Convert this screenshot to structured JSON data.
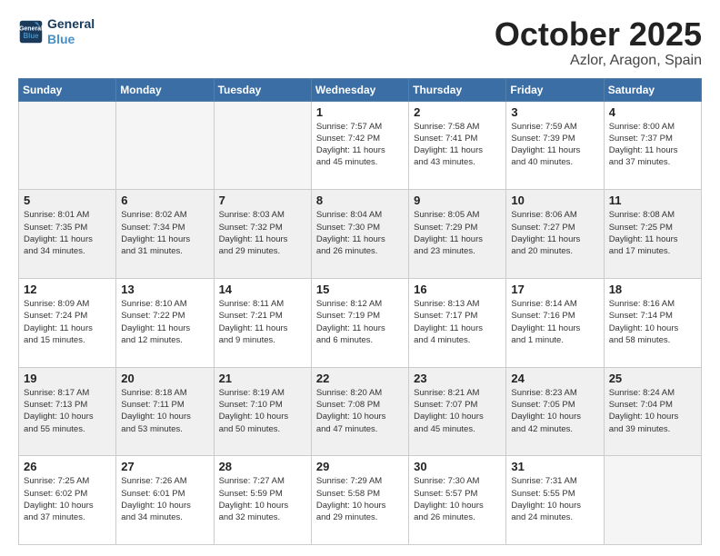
{
  "header": {
    "logo_line1": "General",
    "logo_line2": "Blue",
    "month": "October 2025",
    "location": "Azlor, Aragon, Spain"
  },
  "weekdays": [
    "Sunday",
    "Monday",
    "Tuesday",
    "Wednesday",
    "Thursday",
    "Friday",
    "Saturday"
  ],
  "weeks": [
    [
      {
        "day": "",
        "text": ""
      },
      {
        "day": "",
        "text": ""
      },
      {
        "day": "",
        "text": ""
      },
      {
        "day": "1",
        "text": "Sunrise: 7:57 AM\nSunset: 7:42 PM\nDaylight: 11 hours\nand 45 minutes."
      },
      {
        "day": "2",
        "text": "Sunrise: 7:58 AM\nSunset: 7:41 PM\nDaylight: 11 hours\nand 43 minutes."
      },
      {
        "day": "3",
        "text": "Sunrise: 7:59 AM\nSunset: 7:39 PM\nDaylight: 11 hours\nand 40 minutes."
      },
      {
        "day": "4",
        "text": "Sunrise: 8:00 AM\nSunset: 7:37 PM\nDaylight: 11 hours\nand 37 minutes."
      }
    ],
    [
      {
        "day": "5",
        "text": "Sunrise: 8:01 AM\nSunset: 7:35 PM\nDaylight: 11 hours\nand 34 minutes."
      },
      {
        "day": "6",
        "text": "Sunrise: 8:02 AM\nSunset: 7:34 PM\nDaylight: 11 hours\nand 31 minutes."
      },
      {
        "day": "7",
        "text": "Sunrise: 8:03 AM\nSunset: 7:32 PM\nDaylight: 11 hours\nand 29 minutes."
      },
      {
        "day": "8",
        "text": "Sunrise: 8:04 AM\nSunset: 7:30 PM\nDaylight: 11 hours\nand 26 minutes."
      },
      {
        "day": "9",
        "text": "Sunrise: 8:05 AM\nSunset: 7:29 PM\nDaylight: 11 hours\nand 23 minutes."
      },
      {
        "day": "10",
        "text": "Sunrise: 8:06 AM\nSunset: 7:27 PM\nDaylight: 11 hours\nand 20 minutes."
      },
      {
        "day": "11",
        "text": "Sunrise: 8:08 AM\nSunset: 7:25 PM\nDaylight: 11 hours\nand 17 minutes."
      }
    ],
    [
      {
        "day": "12",
        "text": "Sunrise: 8:09 AM\nSunset: 7:24 PM\nDaylight: 11 hours\nand 15 minutes."
      },
      {
        "day": "13",
        "text": "Sunrise: 8:10 AM\nSunset: 7:22 PM\nDaylight: 11 hours\nand 12 minutes."
      },
      {
        "day": "14",
        "text": "Sunrise: 8:11 AM\nSunset: 7:21 PM\nDaylight: 11 hours\nand 9 minutes."
      },
      {
        "day": "15",
        "text": "Sunrise: 8:12 AM\nSunset: 7:19 PM\nDaylight: 11 hours\nand 6 minutes."
      },
      {
        "day": "16",
        "text": "Sunrise: 8:13 AM\nSunset: 7:17 PM\nDaylight: 11 hours\nand 4 minutes."
      },
      {
        "day": "17",
        "text": "Sunrise: 8:14 AM\nSunset: 7:16 PM\nDaylight: 11 hours\nand 1 minute."
      },
      {
        "day": "18",
        "text": "Sunrise: 8:16 AM\nSunset: 7:14 PM\nDaylight: 10 hours\nand 58 minutes."
      }
    ],
    [
      {
        "day": "19",
        "text": "Sunrise: 8:17 AM\nSunset: 7:13 PM\nDaylight: 10 hours\nand 55 minutes."
      },
      {
        "day": "20",
        "text": "Sunrise: 8:18 AM\nSunset: 7:11 PM\nDaylight: 10 hours\nand 53 minutes."
      },
      {
        "day": "21",
        "text": "Sunrise: 8:19 AM\nSunset: 7:10 PM\nDaylight: 10 hours\nand 50 minutes."
      },
      {
        "day": "22",
        "text": "Sunrise: 8:20 AM\nSunset: 7:08 PM\nDaylight: 10 hours\nand 47 minutes."
      },
      {
        "day": "23",
        "text": "Sunrise: 8:21 AM\nSunset: 7:07 PM\nDaylight: 10 hours\nand 45 minutes."
      },
      {
        "day": "24",
        "text": "Sunrise: 8:23 AM\nSunset: 7:05 PM\nDaylight: 10 hours\nand 42 minutes."
      },
      {
        "day": "25",
        "text": "Sunrise: 8:24 AM\nSunset: 7:04 PM\nDaylight: 10 hours\nand 39 minutes."
      }
    ],
    [
      {
        "day": "26",
        "text": "Sunrise: 7:25 AM\nSunset: 6:02 PM\nDaylight: 10 hours\nand 37 minutes."
      },
      {
        "day": "27",
        "text": "Sunrise: 7:26 AM\nSunset: 6:01 PM\nDaylight: 10 hours\nand 34 minutes."
      },
      {
        "day": "28",
        "text": "Sunrise: 7:27 AM\nSunset: 5:59 PM\nDaylight: 10 hours\nand 32 minutes."
      },
      {
        "day": "29",
        "text": "Sunrise: 7:29 AM\nSunset: 5:58 PM\nDaylight: 10 hours\nand 29 minutes."
      },
      {
        "day": "30",
        "text": "Sunrise: 7:30 AM\nSunset: 5:57 PM\nDaylight: 10 hours\nand 26 minutes."
      },
      {
        "day": "31",
        "text": "Sunrise: 7:31 AM\nSunset: 5:55 PM\nDaylight: 10 hours\nand 24 minutes."
      },
      {
        "day": "",
        "text": ""
      }
    ]
  ]
}
